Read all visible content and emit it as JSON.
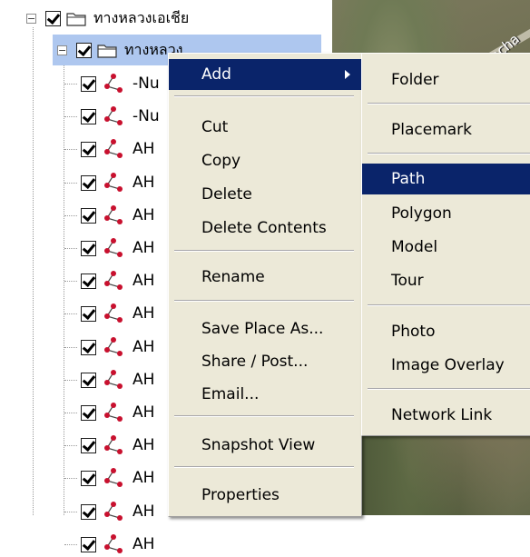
{
  "map": {
    "label": "Pracha"
  },
  "tree": {
    "root": {
      "label": "ทางหลวงเอเชีย",
      "expander": "−"
    },
    "child": {
      "label": "ทางหลวง",
      "expander": "−"
    },
    "items": [
      {
        "label": "-Nu"
      },
      {
        "label": "-Nu"
      },
      {
        "label": "AH"
      },
      {
        "label": "AH"
      },
      {
        "label": "AH"
      },
      {
        "label": "AH"
      },
      {
        "label": "AH"
      },
      {
        "label": "AH"
      },
      {
        "label": "AH"
      },
      {
        "label": "AH"
      },
      {
        "label": "AH"
      },
      {
        "label": "AH"
      },
      {
        "label": "AH"
      },
      {
        "label": "AH"
      },
      {
        "label": "AH"
      }
    ]
  },
  "context_menu": {
    "items": [
      {
        "label": "Add",
        "highlighted": true,
        "has_submenu": true
      },
      {
        "label": "Cut"
      },
      {
        "label": "Copy"
      },
      {
        "label": "Delete"
      },
      {
        "label": "Delete Contents"
      },
      {
        "label": "Rename"
      },
      {
        "label": "Save Place As..."
      },
      {
        "label": "Share / Post..."
      },
      {
        "label": "Email..."
      },
      {
        "label": "Snapshot View"
      },
      {
        "label": "Properties"
      }
    ]
  },
  "add_submenu": {
    "items": [
      {
        "label": "Folder"
      },
      {
        "label": "Placemark"
      },
      {
        "label": "Path",
        "highlighted": true
      },
      {
        "label": "Polygon"
      },
      {
        "label": "Model"
      },
      {
        "label": "Tour"
      },
      {
        "label": "Photo"
      },
      {
        "label": "Image Overlay"
      },
      {
        "label": "Network Link"
      }
    ]
  },
  "colors": {
    "menu_bg": "#ece9d8",
    "highlight": "#0a246a",
    "selection": "#aec7ef",
    "path_icon": "#c8102e"
  },
  "icons": {
    "folder": "folder-icon",
    "path": "path-icon",
    "checkbox": "checkbox-checked-icon",
    "submenu_arrow": "chevron-right-icon"
  }
}
